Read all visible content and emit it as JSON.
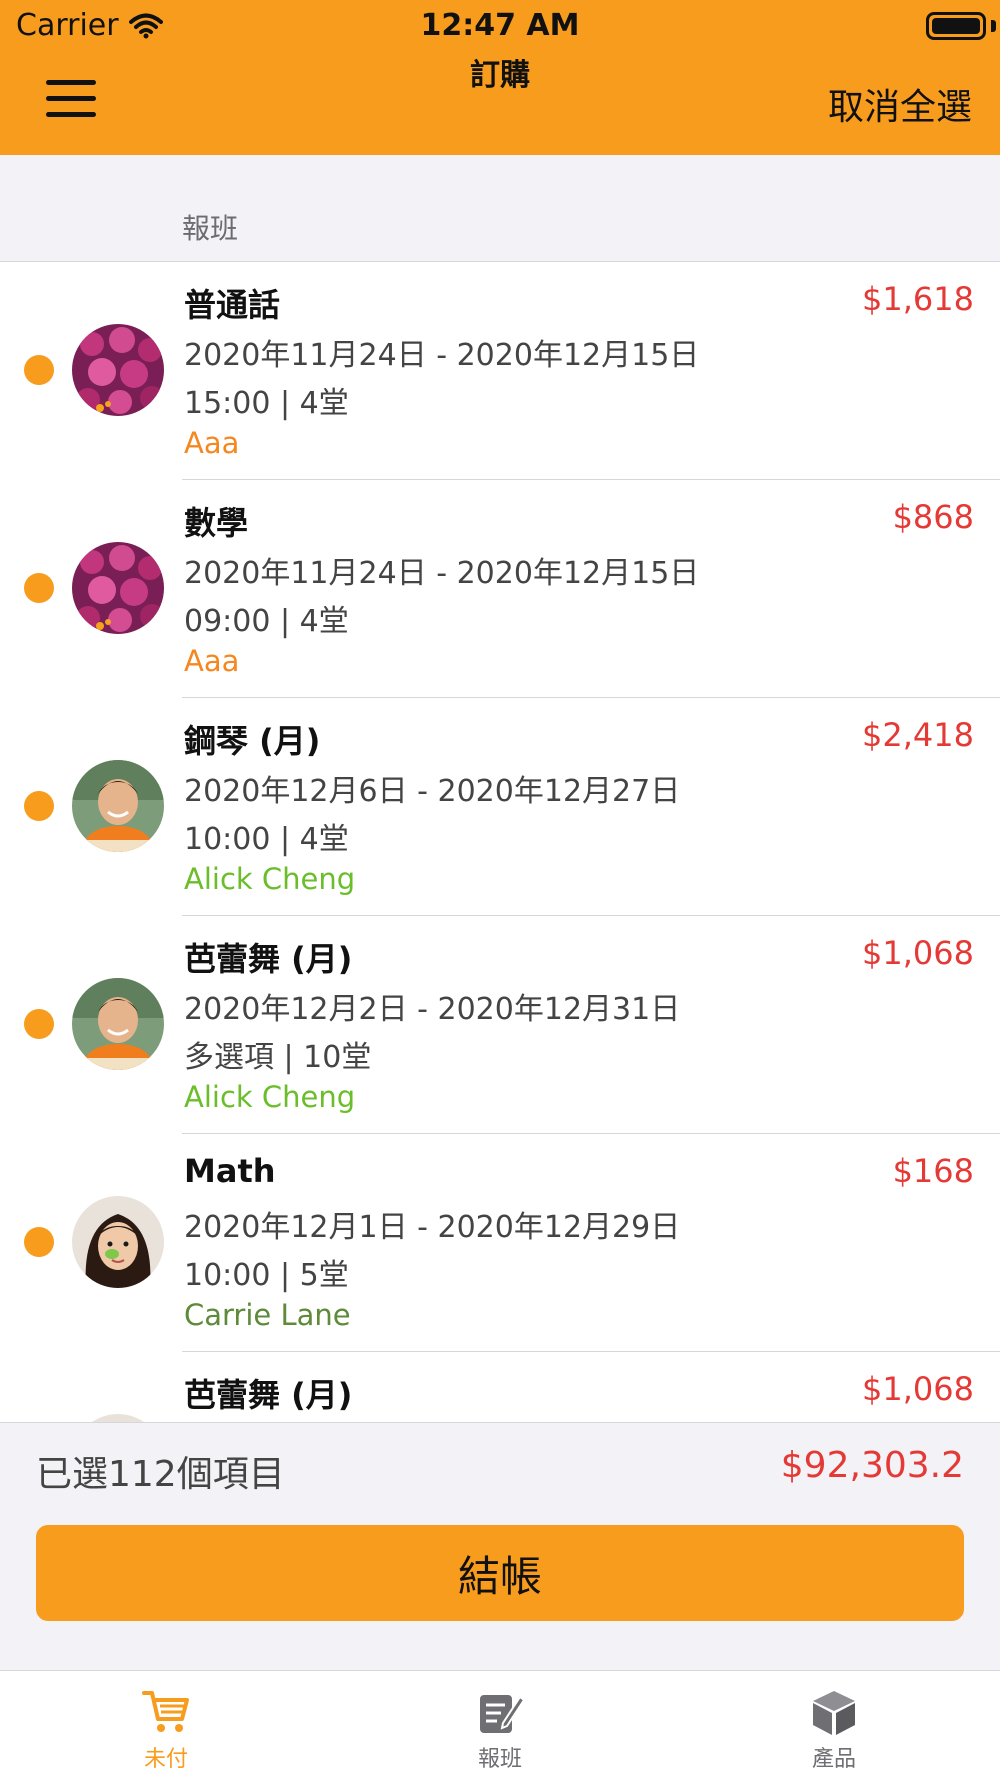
{
  "status_bar": {
    "carrier": "Carrier",
    "time": "12:47 AM"
  },
  "nav": {
    "title": "訂購",
    "right_action": "取消全選",
    "menu_icon": "hamburger-menu-icon"
  },
  "section": {
    "title": "報班"
  },
  "colors": {
    "accent": "#F89C1E",
    "price": "#E53935",
    "student_orange": "#F5871F",
    "student_green": "#6BBE2A",
    "student_olive": "#5E8A3A"
  },
  "items": [
    {
      "name": "普通話",
      "price": "$1,618",
      "dates": "2020年11月24日 - 2020年12月15日",
      "time": "15:00 | 4堂",
      "student": "Aaa",
      "avatar": "flower-avatar",
      "student_color": "#F5871F"
    },
    {
      "name": "數學",
      "price": "$868",
      "dates": "2020年11月24日 - 2020年12月15日",
      "time": "09:00 | 4堂",
      "student": "Aaa",
      "avatar": "flower-avatar",
      "student_color": "#F5871F"
    },
    {
      "name": "鋼琴 (月)",
      "price": "$2,418",
      "dates": "2020年12月6日 - 2020年12月27日",
      "time": "10:00 | 4堂",
      "student": "Alick Cheng",
      "avatar": "boy-avatar",
      "student_color": "#6BBE2A"
    },
    {
      "name": "芭蕾舞 (月)",
      "price": "$1,068",
      "dates": "2020年12月2日 - 2020年12月31日",
      "time": "多選項 | 10堂",
      "student": "Alick Cheng",
      "avatar": "boy-avatar",
      "student_color": "#6BBE2A"
    },
    {
      "name": "Math",
      "price": "$168",
      "dates": "2020年12月1日 - 2020年12月29日",
      "time": "10:00 | 5堂",
      "student": "Carrie Lane",
      "avatar": "girl-avatar",
      "student_color": "#5E8A3A"
    },
    {
      "name": "芭蕾舞 (月)",
      "price": "$1,068",
      "dates": "",
      "time": "",
      "student": "",
      "avatar": "girl-avatar",
      "student_color": "#5E8A3A"
    }
  ],
  "summary": {
    "selected_text": "已選112個項目",
    "total": "$92,303.2",
    "checkout_label": "結帳"
  },
  "tabs": [
    {
      "label": "未付",
      "icon": "cart-icon",
      "active": true
    },
    {
      "label": "報班",
      "icon": "edit-note-icon",
      "active": false
    },
    {
      "label": "產品",
      "icon": "product-box-icon",
      "active": false
    }
  ]
}
